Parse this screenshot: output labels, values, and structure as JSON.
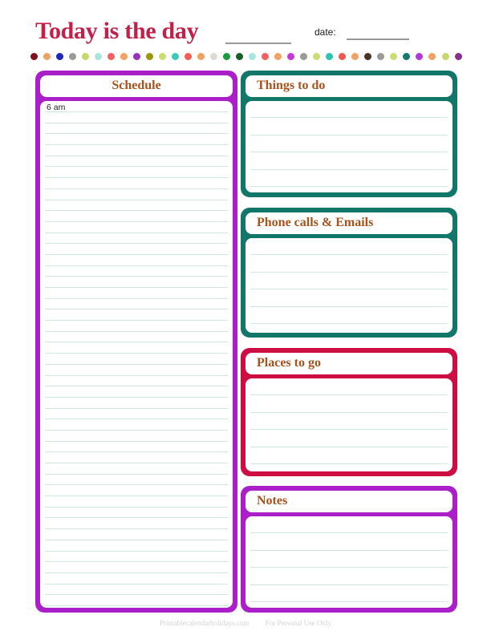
{
  "page": {
    "title": "Today is the day",
    "date_label": "date:",
    "title_blank_line": "",
    "date_blank_line": ""
  },
  "colors": {
    "title_text": "#c32049",
    "heading_text": "#a8521c",
    "purple": "#ab1fc8",
    "teal": "#127768",
    "red": "#ce0e42",
    "rule_line": "#cfe7e0",
    "blank_underline": "#9a9a9a",
    "footer_text": "#d3d3d3"
  },
  "dot_row": {
    "count": 34,
    "colors": [
      "#7e1020",
      "#f0a264",
      "#2027b0",
      "#9b9a95",
      "#c7d86a",
      "#a9e5de",
      "#ec6464",
      "#f4a261",
      "#9a32c0",
      "#9e970e",
      "#c9dd72",
      "#3dc9b4",
      "#ec6055",
      "#f0a262",
      "#dedad6",
      "#1f9b3f",
      "#1b5e2a",
      "#a9e5de",
      "#ec6464",
      "#f4a261",
      "#c43bd4",
      "#9b9a95",
      "#c9dd72",
      "#2fc3b1",
      "#ec5a52",
      "#f4a261",
      "#4a342a",
      "#9b9a95",
      "#c9dd72",
      "#157a6e",
      "#b03ad0",
      "#f0a262",
      "#c7d86a",
      "#8b2f8f"
    ]
  },
  "panels": {
    "schedule": {
      "title": "Schedule",
      "frame_color": "#ab1fc8",
      "title_align": "center",
      "first_time_label": "6 am",
      "line_count": 47
    },
    "things_to_do": {
      "title": "Things to do",
      "frame_color": "#127768",
      "title_align": "left",
      "line_count": 6
    },
    "phone_calls_emails": {
      "title": "Phone calls & Emails",
      "frame_color": "#127768",
      "title_align": "left",
      "line_count": 6
    },
    "places_to_go": {
      "title": "Places to go",
      "frame_color": "#ce0e42",
      "title_align": "left",
      "line_count": 6
    },
    "notes": {
      "title": "Notes",
      "frame_color": "#ab1fc8",
      "title_align": "left",
      "line_count": 6
    }
  },
  "footer": {
    "site": "Printablecalendarholidays.com",
    "usage": "For Personal Use Only"
  }
}
